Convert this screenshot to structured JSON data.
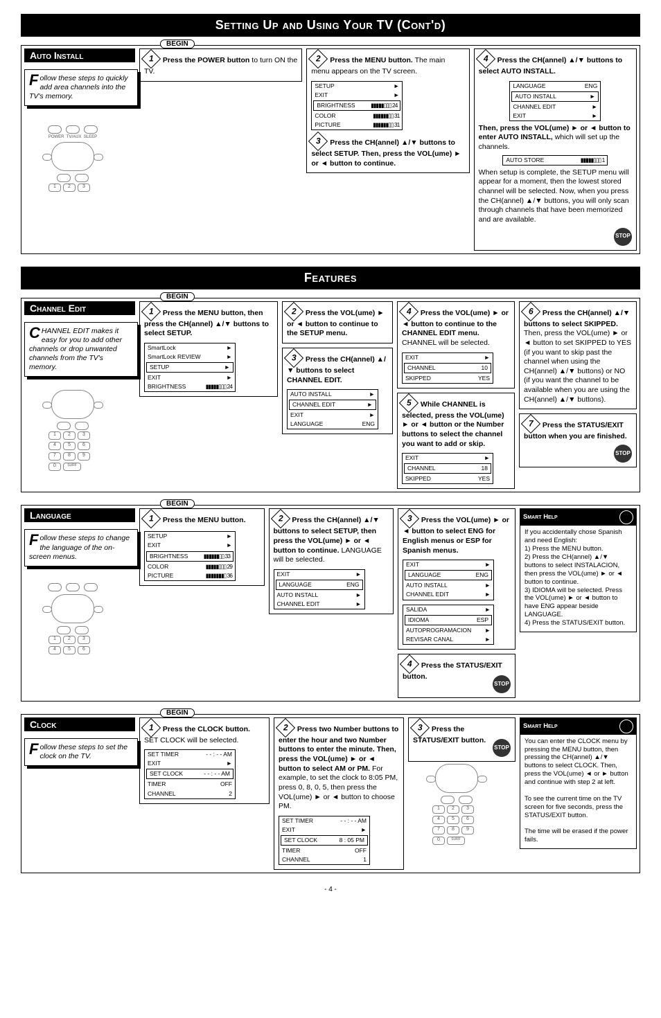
{
  "titles": {
    "main1": "Setting Up and Using Your TV (Cont'd)",
    "main2": "Features"
  },
  "begin": "BEGIN",
  "stop": "STOP",
  "page_num": "- 4 -",
  "auto_install": {
    "label": "Auto Install",
    "intro": "ollow these steps to quickly add area channels into the TV's memory.",
    "intro_cap": "F",
    "step1": "Press the POWER button",
    "step1b": " to turn ON the TV.",
    "step2": "Press the MENU button.",
    "step2b": " The main menu appears on the TV screen.",
    "osd2": {
      "r1": "SETUP",
      "r1v": "►",
      "r2": "EXIT",
      "r2v": "►",
      "r3": "BRIGHTNESS",
      "r3v": "▮▮▮▮▮▯▯▯  24",
      "r4": "COLOR",
      "r4v": "▮▮▮▮▮▮▯▯  31",
      "r5": "PICTURE",
      "r5v": "▮▮▮▮▮▮▯▯  31"
    },
    "step3": "Press the CH(annel) ▲/▼ buttons to select SETUP. Then, press the VOL(ume) ► or ◄ button to continue.",
    "step4a": "Press the CH(annel) ▲/▼ buttons to select AUTO INSTALL.",
    "osd4": {
      "r1": "LANGUAGE",
      "r1v": "ENG",
      "r2": "AUTO INSTALL",
      "r2v": "►",
      "r3": "CHANNEL EDIT",
      "r3v": "►",
      "r4": "EXIT",
      "r4v": "►"
    },
    "step4b": "Then, press the VOL(ume) ► or ◄ button to enter AUTO INSTALL,",
    "step4c": " which will set up the channels.",
    "osd4b": {
      "r1": "AUTO STORE",
      "r1v": "▮▮▮▮▮▯▯▯   1"
    },
    "step4d": "When setup is complete, the SETUP menu will appear for a moment, then the lowest stored channel will be selected. Now, when you press the CH(annel) ▲/▼ buttons, you will only scan through channels that have been memorized and are available."
  },
  "channel_edit": {
    "label": "Channel Edit",
    "intro_cap": "C",
    "intro": "HANNEL EDIT makes it easy for you to add other channels or drop unwanted channels from the TV's memory.",
    "step1": "Press the MENU button, then press the CH(annel) ▲/▼ buttons to select SETUP.",
    "osd1": {
      "r1": "SmartLock",
      "r1v": "►",
      "r2": "SmartLock REVIEW",
      "r2v": "►",
      "r3": "SETUP",
      "r3v": "►",
      "r4": "EXIT",
      "r4v": "►",
      "r5": "BRIGHTNESS",
      "r5v": "▮▮▮▮▮▯▯▯  24"
    },
    "step2": "Press the VOL(ume) ► or ◄ button to continue to the SETUP menu.",
    "step3": "Press the CH(annel) ▲/▼ buttons to select CHANNEL EDIT.",
    "osd3": {
      "r1": "AUTO INSTALL",
      "r1v": "►",
      "r2": "CHANNEL EDIT",
      "r2v": "►",
      "r3": "EXIT",
      "r3v": "►",
      "r4": "LANGUAGE",
      "r4v": "ENG"
    },
    "step4": "Press the VOL(ume) ► or ◄ button to continue to the CHANNEL EDIT menu.",
    "step4b": " CHANNEL will be selected.",
    "osd4": {
      "r1": "EXIT",
      "r1v": "►",
      "r2": "CHANNEL",
      "r2v": "10",
      "r3": "SKIPPED",
      "r3v": "YES"
    },
    "step5": "While CHANNEL is selected, press the VOL(ume) ► or ◄ button or the Number buttons to select the channel you want to add or skip.",
    "osd5": {
      "r1": "EXIT",
      "r1v": "►",
      "r2": "CHANNEL",
      "r2v": "18",
      "r3": "SKIPPED",
      "r3v": "YES"
    },
    "step6": "Press the CH(annel) ▲/▼ buttons to select SKIPPED.",
    "step6b": "Then, press the VOL(ume) ► or ◄ button to set SKIPPED to YES (if you want to skip past the channel when using the CH(annel) ▲/▼ buttons) or NO (if you want the channel to be available when you are using the CH(annel) ▲/▼ buttons).",
    "step7": "Press the STATUS/EXIT button when you are finished."
  },
  "language": {
    "label": "Language",
    "intro_cap": "F",
    "intro": "ollow these steps to change the language of the on-screen menus.",
    "step1": "Press the MENU button.",
    "osd1": {
      "r1": "SETUP",
      "r1v": "►",
      "r2": "EXIT",
      "r2v": "►",
      "r3": "BRIGHTNESS",
      "r3v": "▮▮▮▮▮▮▯▯  33",
      "r4": "COLOR",
      "r4v": "▮▮▮▮▮▯▯▯  29",
      "r5": "PICTURE",
      "r5v": "▮▮▮▮▮▮▮▯  36"
    },
    "step2": "Press the CH(annel) ▲/▼ buttons to select SETUP, then press the VOL(ume) ► or ◄ button to continue.",
    "step2b": " LANGUAGE will be selected.",
    "osd2": {
      "r1": "EXIT",
      "r1v": "►",
      "r2": "LANGUAGE",
      "r2v": "ENG",
      "r3": "AUTO INSTALL",
      "r3v": "►",
      "r4": "CHANNEL EDIT",
      "r4v": "►"
    },
    "step3": "Press the VOL(ume) ► or ◄ button to select ENG for English menus or ESP for Spanish menus.",
    "osd3a": {
      "r1": "EXIT",
      "r1v": "►",
      "r2": "LANGUAGE",
      "r2v": "ENG",
      "r3": "AUTO INSTALL",
      "r3v": "►",
      "r4": "CHANNEL EDIT",
      "r4v": "►"
    },
    "osd3b": {
      "r1": "SALIDA",
      "r1v": "►",
      "r2": "IDIOMA",
      "r2v": "ESP",
      "r3": "AUTOPROGRAMACION",
      "r3v": "►",
      "r4": "REVISAR CANAL",
      "r4v": "►"
    },
    "step4": "Press the STATUS/EXIT button.",
    "smart": {
      "title": "Smart Help",
      "body": "If you accidentally chose Spanish and need English:\n1) Press the MENU button.\n2) Press the CH(annel) ▲/▼ buttons to select INSTALACION, then press the VOL(ume) ► or ◄ button to continue.\n3) IDIOMA will be selected. Press the VOL(ume) ► or ◄ button to have ENG appear beside LANGUAGE.\n4) Press the STATUS/EXIT button."
    }
  },
  "clock": {
    "label": "Clock",
    "intro_cap": "F",
    "intro": "ollow these steps to set the clock on the TV.",
    "step1": "Press the CLOCK button.",
    "step1b": " SET CLOCK will be selected.",
    "osd1": {
      "r1": "SET TIMER",
      "r1v": "- - : - - AM",
      "r2": "EXIT",
      "r2v": "►",
      "r3": "SET CLOCK",
      "r3v": "- - : - - AM",
      "r4": "TIMER",
      "r4v": "OFF",
      "r5": "CHANNEL",
      "r5v": "2"
    },
    "step2": "Press two Number buttons to enter the hour and two Number buttons to enter the minute. Then, press the VOL(ume) ► or ◄ button to select AM or PM.",
    "step2b": " For example, to set the clock to 8:05 PM, press 0, 8, 0, 5, then press the VOL(ume) ► or ◄ button to choose PM.",
    "osd2": {
      "r1": "SET TIMER",
      "r1v": "- - : - - AM",
      "r2": "EXIT",
      "r2v": "►",
      "r3": "SET CLOCK",
      "r3v": "8 : 05 PM",
      "r4": "TIMER",
      "r4v": "OFF",
      "r5": "CHANNEL",
      "r5v": "1"
    },
    "step3": "Press the STATUS/EXIT button.",
    "smart": {
      "title": "Smart Help",
      "body1": "You can enter the CLOCK menu by pressing the MENU button, then pressing the CH(annel) ▲/▼ buttons to select CLOCK. Then, press the VOL(ume) ◄ or ► button and continue with step 2 at left.",
      "body2": "To see the current time on the TV screen for five seconds, press the STATUS/EXIT button.",
      "body3": "The time will be erased if the power fails."
    }
  }
}
